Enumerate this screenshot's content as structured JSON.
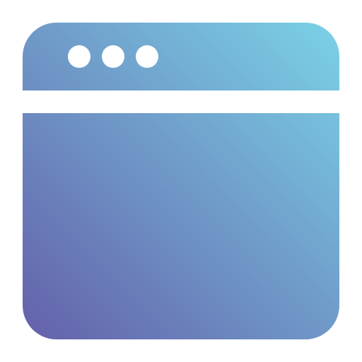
{
  "icon": {
    "name": "browser-window-icon",
    "gradient_start": "#6460AA",
    "gradient_end": "#7AD2E6",
    "separator_color": "#FFFFFF",
    "dot_color": "#FFFFFF",
    "dots": [
      "dot-1",
      "dot-2",
      "dot-3"
    ]
  }
}
